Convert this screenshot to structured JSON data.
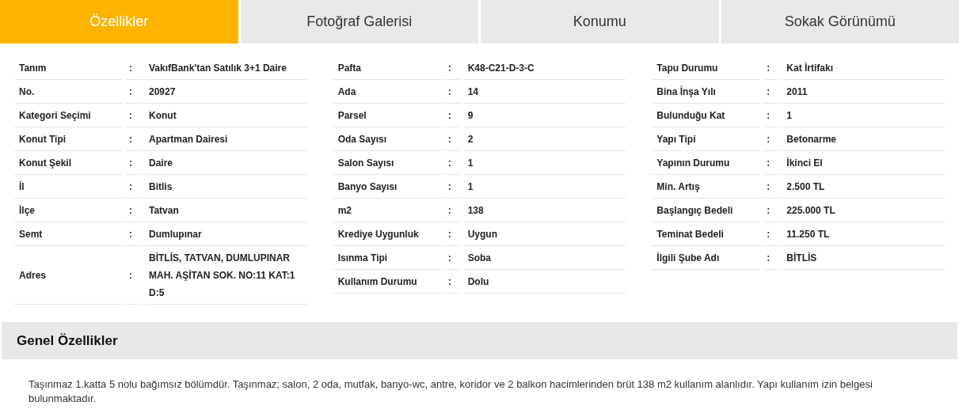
{
  "tabs": [
    {
      "label": "Özellikler",
      "selected": true
    },
    {
      "label": "Fotoğraf Galerisi",
      "selected": false
    },
    {
      "label": "Konumu",
      "selected": false
    },
    {
      "label": "Sokak Görünümü",
      "selected": false
    }
  ],
  "property_tables": [
    {
      "rows": [
        {
          "label": "Tanım",
          "separator": ":",
          "value": "VakıfBank'tan Satılık 3+1 Daire"
        },
        {
          "label": "No.",
          "separator": ":",
          "value": "20927"
        },
        {
          "label": "Kategori Seçimi",
          "separator": ":",
          "value": "Konut"
        },
        {
          "label": "Konut Tipi",
          "separator": ":",
          "value": "Apartman Dairesi"
        },
        {
          "label": "Konut Şekil",
          "separator": ":",
          "value": "Daire"
        },
        {
          "label": "İl",
          "separator": ":",
          "value": "Bitlis"
        },
        {
          "label": "İlçe",
          "separator": ":",
          "value": "Tatvan"
        },
        {
          "label": "Semt",
          "separator": ":",
          "value": "Dumlupınar"
        },
        {
          "label": "Adres",
          "separator": ":",
          "value": "BİTLİS, TATVAN, DUMLUPINAR MAH. AŞİTAN SOK. NO:11 KAT:1 D:5"
        }
      ]
    },
    {
      "rows": [
        {
          "label": "Pafta",
          "separator": ":",
          "value": "K48-C21-D-3-C"
        },
        {
          "label": "Ada",
          "separator": ":",
          "value": "14"
        },
        {
          "label": "Parsel",
          "separator": ":",
          "value": "9"
        },
        {
          "label": "Oda Sayısı",
          "separator": ":",
          "value": "2"
        },
        {
          "label": "Salon Sayısı",
          "separator": ":",
          "value": "1"
        },
        {
          "label": "Banyo Sayısı",
          "separator": ":",
          "value": "1"
        },
        {
          "label": "m2",
          "separator": ":",
          "value": "138"
        },
        {
          "label": "Krediye Uygunluk",
          "separator": ":",
          "value": "Uygun"
        },
        {
          "label": "Isınma Tipi",
          "separator": ":",
          "value": "Soba"
        },
        {
          "label": "Kullanım Durumu",
          "separator": ":",
          "value": "Dolu"
        }
      ]
    },
    {
      "rows": [
        {
          "label": "Tapu Durumu",
          "separator": ":",
          "value": "Kat İrtifakı"
        },
        {
          "label": "Bina İnşa Yılı",
          "separator": ":",
          "value": "2011"
        },
        {
          "label": "Bulunduğu Kat",
          "separator": ":",
          "value": "1"
        },
        {
          "label": "Yapı Tipi",
          "separator": ":",
          "value": "Betonarme"
        },
        {
          "label": "Yapının Durumu",
          "separator": ":",
          "value": "İkinci El"
        },
        {
          "label": "Min. Artış",
          "separator": ":",
          "value": "2.500 TL"
        },
        {
          "label": "Başlangıç Bedeli",
          "separator": ":",
          "value": "225.000 TL"
        },
        {
          "label": "Teminat Bedeli",
          "separator": ":",
          "value": "11.250 TL"
        },
        {
          "label": "İlgili Şube Adı",
          "separator": ":",
          "value": "BİTLİS"
        }
      ]
    }
  ],
  "general_features": {
    "title": "Genel Özellikler",
    "description": "Taşınmaz 1.katta 5 nolu bağımsız bölümdür. Taşınmaz; salon, 2 oda, mutfak, banyo-wc, antre, koridor ve 2 balkon hacimlerinden brüt 138 m2 kullanım alanlıdır. Yapı kullanım izin belgesi bulunmaktadır."
  }
}
